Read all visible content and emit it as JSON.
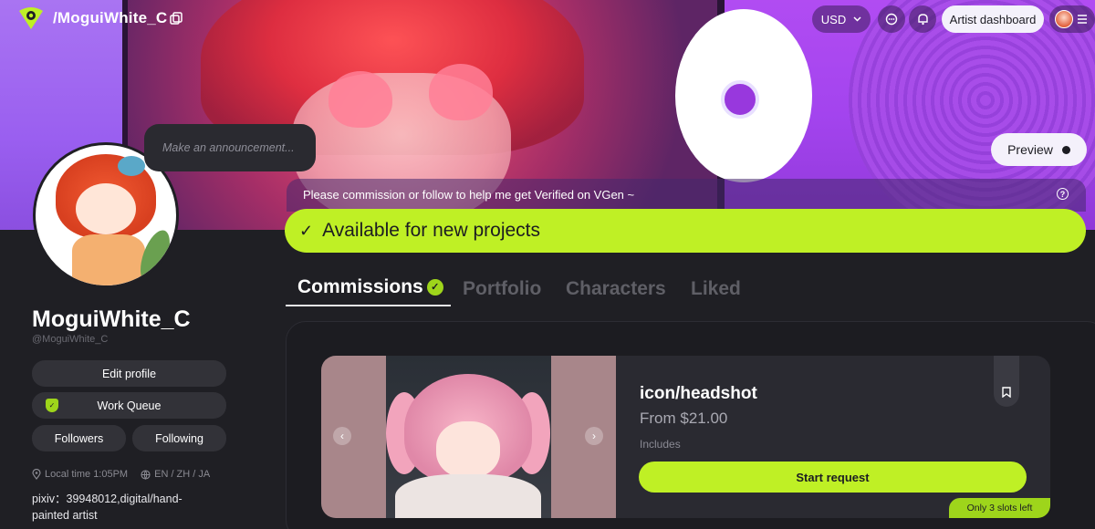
{
  "topbar": {
    "title": "/MoguiWhite_C",
    "currency": "USD",
    "dashboard_label": "Artist dashboard"
  },
  "announcement": {
    "placeholder": "Make an announcement..."
  },
  "preview": {
    "label": "Preview"
  },
  "note": "Please commission or follow to help me get Verified on VGen ~",
  "availability": {
    "label": "Available for new projects"
  },
  "tabs": [
    {
      "label": "Commissions",
      "active": true
    },
    {
      "label": "Portfolio",
      "active": false
    },
    {
      "label": "Characters",
      "active": false
    },
    {
      "label": "Liked",
      "active": false
    }
  ],
  "profile": {
    "display_name": "MoguiWhite_C",
    "handle": "@MoguiWhite_C",
    "edit_label": "Edit profile",
    "queue_label": "Work Queue",
    "followers_label": "Followers",
    "following_label": "Following",
    "local_time": "Local time 1:05PM",
    "languages": "EN / ZH / JA",
    "bio": "pixiv：39948012,digital/hand-painted artist"
  },
  "commission_card": {
    "title": "icon/headshot",
    "price": "From $21.00",
    "includes_label": "Includes",
    "start_label": "Start request",
    "slots_badge": "Only 3 slots left"
  },
  "colors": {
    "accent": "#bff025",
    "background": "#1f1f24",
    "card": "#2a2a31"
  }
}
